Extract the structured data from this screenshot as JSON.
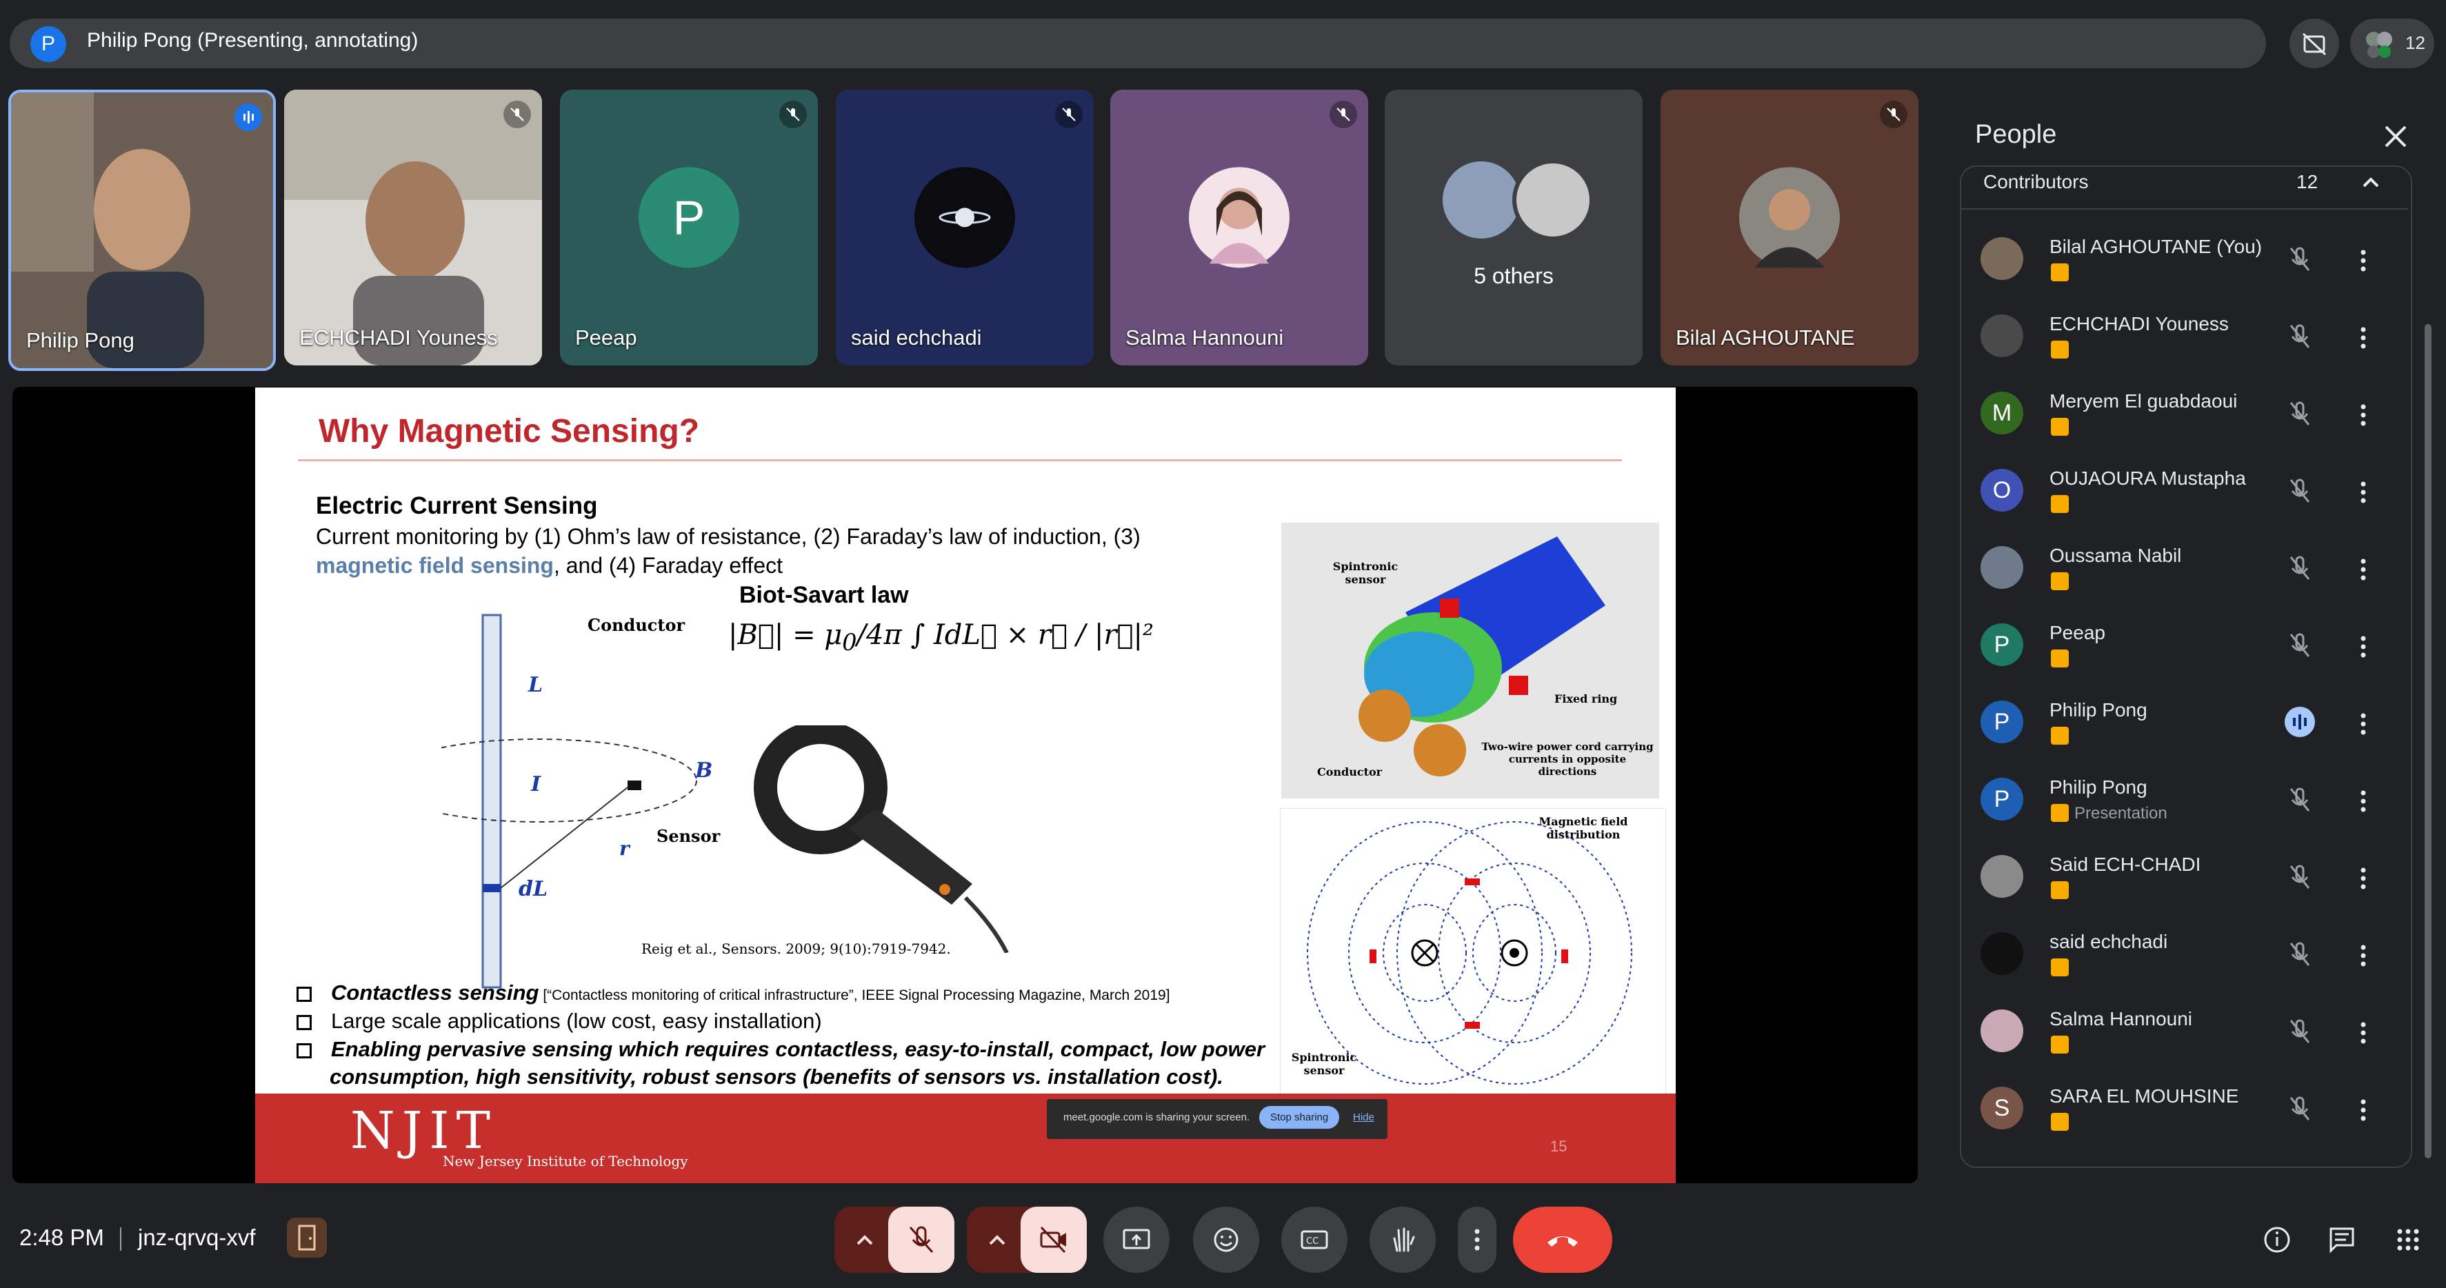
{
  "top": {
    "presenter_initial": "P",
    "presenter_label": "Philip Pong (Presenting, annotating)",
    "people_count": "12"
  },
  "tiles": [
    {
      "name": "Philip Pong"
    },
    {
      "name": "ECHCHADI Youness"
    },
    {
      "name": "Peeap",
      "initial": "P"
    },
    {
      "name": "said echchadi"
    },
    {
      "name": "Salma Hannouni"
    },
    {
      "name": "",
      "others_label": "5 others"
    },
    {
      "name": "Bilal AGHOUTANE"
    }
  ],
  "slide": {
    "title": "Why Magnetic Sensing?",
    "section_heading": "Electric Current Sensing",
    "intro_line1": "Current monitoring by (1) Ohm’s law of resistance, (2) Faraday’s law of induction, (3)",
    "intro_accent": "magnetic field sensing",
    "intro_line2_rest": ", and (4) Faraday effect",
    "biot_label": "Biot-Savart law",
    "diagram_labels": {
      "conductor": "Conductor",
      "L": "L",
      "I": "I",
      "dL": "dL",
      "r": "r",
      "B": "B",
      "sensor": "Sensor",
      "citation": "Reig et al., Sensors. 2009; 9(10):7919-7942."
    },
    "cable_labels": {
      "spintronic_sensor": "Spintronic sensor",
      "fixed_ring": "Fixed ring",
      "conductor": "Conductor",
      "two_wire": "Two-wire power cord carrying currents in opposite directions",
      "field_dist": "Magnetic field distribution",
      "spintronic_sensor_2": "Spintronic sensor"
    },
    "bullet1_bold": "Contactless sensing",
    "bullet1_ref": " [“Contactless monitoring of critical infrastructure”, IEEE Signal Processing Magazine, March 2019]",
    "bullet2": "Large scale applications (low cost, easy installation)",
    "bullet3_line1": "Enabling pervasive sensing which requires contactless, easy-to-install, compact, low power",
    "bullet3_line2": "consumption, high sensitivity, robust sensors (benefits of sensors vs. installation cost).",
    "logo": "NJIT",
    "logo_sub": "New Jersey Institute of Technology",
    "page_number": "15",
    "share_toast_text": "meet.google.com is sharing your screen.",
    "share_stop": "Stop sharing",
    "share_hide": "Hide"
  },
  "people": {
    "title": "People",
    "section": "Contributors",
    "count": "12",
    "list": [
      {
        "name": "Bilal AGHOUTANE (You)",
        "initial": "",
        "color": "#7a6a5a",
        "sub": ""
      },
      {
        "name": "ECHCHADI Youness",
        "initial": "",
        "color": "#4a4a4a",
        "sub": ""
      },
      {
        "name": "Meryem El guabdaoui",
        "initial": "M",
        "color": "#33691e",
        "sub": ""
      },
      {
        "name": "OUJAOURA Mustapha",
        "initial": "O",
        "color": "#3f51b5",
        "sub": ""
      },
      {
        "name": "Oussama Nabil",
        "initial": "",
        "color": "#6d7b8a",
        "sub": ""
      },
      {
        "name": "Peeap",
        "initial": "P",
        "color": "#1e7a63",
        "sub": ""
      },
      {
        "name": "Philip Pong",
        "initial": "P",
        "color": "#1e5fb4",
        "sub": ""
      },
      {
        "name": "Philip Pong",
        "initial": "P",
        "color": "#1e5fb4",
        "sub": "Presentation"
      },
      {
        "name": "Said ECH-CHADI",
        "initial": "",
        "color": "#8a8a8a",
        "sub": ""
      },
      {
        "name": "said echchadi",
        "initial": "",
        "color": "#111111",
        "sub": ""
      },
      {
        "name": "Salma Hannouni",
        "initial": "",
        "color": "#c9a9b4",
        "sub": ""
      },
      {
        "name": "SARA EL MOUHSINE",
        "initial": "S",
        "color": "#795548",
        "sub": ""
      }
    ]
  },
  "bottom": {
    "time": "2:48 PM",
    "code": "jnz-qrvq-xvf"
  },
  "colors": {
    "background": "#202124",
    "surface": "#3c4043",
    "end_call": "#ea4335",
    "slide_red": "#c62f2b",
    "badge": "#f9ab00"
  }
}
